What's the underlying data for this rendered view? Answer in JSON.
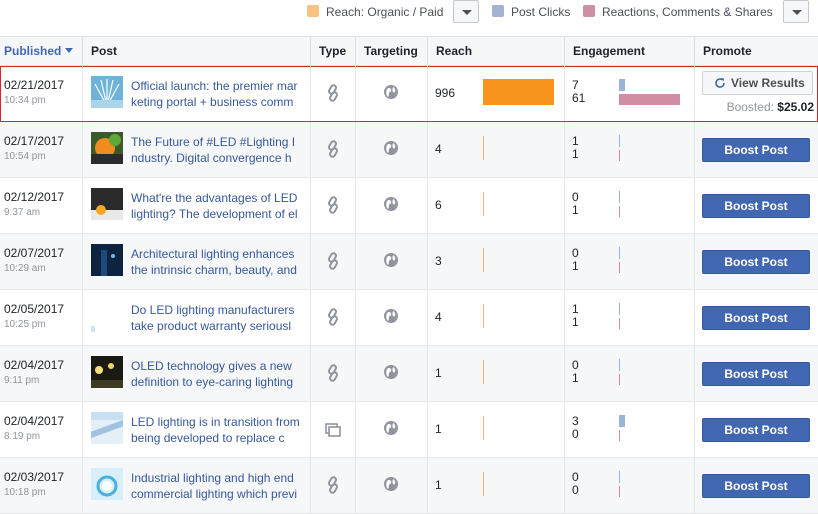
{
  "legend": {
    "reach_label": "Reach: Organic / Paid",
    "reach_color": "#f7c381",
    "clicks_label": "Post Clicks",
    "clicks_color": "#a3b3d1",
    "reactions_label": "Reactions, Comments & Shares",
    "reactions_color": "#d08ea3"
  },
  "columns": {
    "published": "Published",
    "post": "Post",
    "type": "Type",
    "targeting": "Targeting",
    "reach": "Reach",
    "engagement": "Engagement",
    "promote": "Promote"
  },
  "boost_label": "Boost Post",
  "view_results_label": "View Results",
  "boosted_label": "Boosted:",
  "boosted_amount": "$25.02",
  "rows": [
    {
      "date": "02/21/2017",
      "time": "10:34 pm",
      "text": "Official launch: the premier marketing portal + business comm",
      "type": "link-icon",
      "reach": "996",
      "reach_fraction": 1.0,
      "clicks": "7",
      "reactions": "61",
      "clicks_fraction": 0.1,
      "reactions_fraction": 1.0,
      "promote": "view",
      "thumb": "fan"
    },
    {
      "date": "02/17/2017",
      "time": "10:54 pm",
      "text": "The Future of #LED #Lighting Industry. Digital convergence h",
      "type": "link-icon",
      "reach": "4",
      "reach_fraction": 0.0,
      "clicks": "1",
      "reactions": "1",
      "clicks_fraction": 0.0,
      "reactions_fraction": 0.0,
      "promote": "boost",
      "thumb": "green-orange"
    },
    {
      "date": "02/12/2017",
      "time": "9:37 am",
      "text": "What're the advantages of LED lighting? The development of el",
      "type": "link-icon",
      "reach": "6",
      "reach_fraction": 0.0,
      "clicks": "0",
      "reactions": "1",
      "clicks_fraction": 0.0,
      "reactions_fraction": 0.0,
      "promote": "boost",
      "thumb": "dark-lamp"
    },
    {
      "date": "02/07/2017",
      "time": "10:29 am",
      "text": "Architectural lighting enhances the intrinsic charm, beauty, and",
      "type": "link-icon",
      "reach": "3",
      "reach_fraction": 0.0,
      "clicks": "0",
      "reactions": "1",
      "clicks_fraction": 0.0,
      "reactions_fraction": 0.0,
      "promote": "boost",
      "thumb": "night-blue"
    },
    {
      "date": "02/05/2017",
      "time": "10:25 pm",
      "text": "Do LED lighting manufacturers take product warranty seriousl",
      "type": "link-icon",
      "reach": "4",
      "reach_fraction": 0.0,
      "clicks": "1",
      "reactions": "1",
      "clicks_fraction": 0.0,
      "reactions_fraction": 0.0,
      "promote": "boost",
      "thumb": "white"
    },
    {
      "date": "02/04/2017",
      "time": "9:11 pm",
      "text": "OLED technology gives a new definition to eye-caring lighting",
      "type": "link-icon",
      "reach": "1",
      "reach_fraction": 0.0,
      "clicks": "0",
      "reactions": "1",
      "clicks_fraction": 0.0,
      "reactions_fraction": 0.0,
      "promote": "boost",
      "thumb": "lamps"
    },
    {
      "date": "02/04/2017",
      "time": "8:19 pm",
      "text": "LED lighting is in transition from being developed to replace c",
      "type": "album-icon",
      "reach": "1",
      "reach_fraction": 0.0,
      "clicks": "3",
      "reactions": "0",
      "clicks_fraction": 0.04,
      "reactions_fraction": 0.0,
      "promote": "boost",
      "thumb": "tube"
    },
    {
      "date": "02/03/2017",
      "time": "10:18 pm",
      "text": "Industrial lighting and high end commercial lighting which previ",
      "type": "link-icon",
      "reach": "1",
      "reach_fraction": 0.0,
      "clicks": "0",
      "reactions": "0",
      "clicks_fraction": 0.0,
      "reactions_fraction": 0.0,
      "promote": "boost",
      "thumb": "ring"
    }
  ]
}
